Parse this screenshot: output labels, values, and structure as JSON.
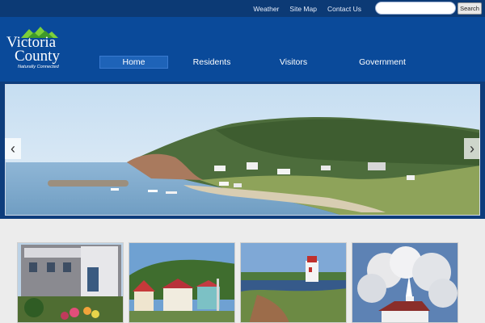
{
  "top_links": [
    "Weather",
    "Site Map",
    "Contact Us"
  ],
  "search": {
    "placeholder": "",
    "button_label": "Search"
  },
  "logo": {
    "line1": "Victoria",
    "line2": "County",
    "tagline": "Naturally Connected"
  },
  "nav": [
    {
      "label": "Home",
      "active": true
    },
    {
      "label": "Residents",
      "active": false
    },
    {
      "label": "Visitors",
      "active": false
    },
    {
      "label": "Government",
      "active": false
    }
  ],
  "slider": {
    "prev_glyph": "‹",
    "next_glyph": "›"
  },
  "colors": {
    "topbar": "#0c3a75",
    "header": "#0a4a9a",
    "nav_active": "#1e63b8",
    "logo_green": "#7ccf3a"
  },
  "gallery_icons": [
    "town-hall-photo",
    "houses-photo",
    "lighthouse-photo",
    "church-photo"
  ]
}
